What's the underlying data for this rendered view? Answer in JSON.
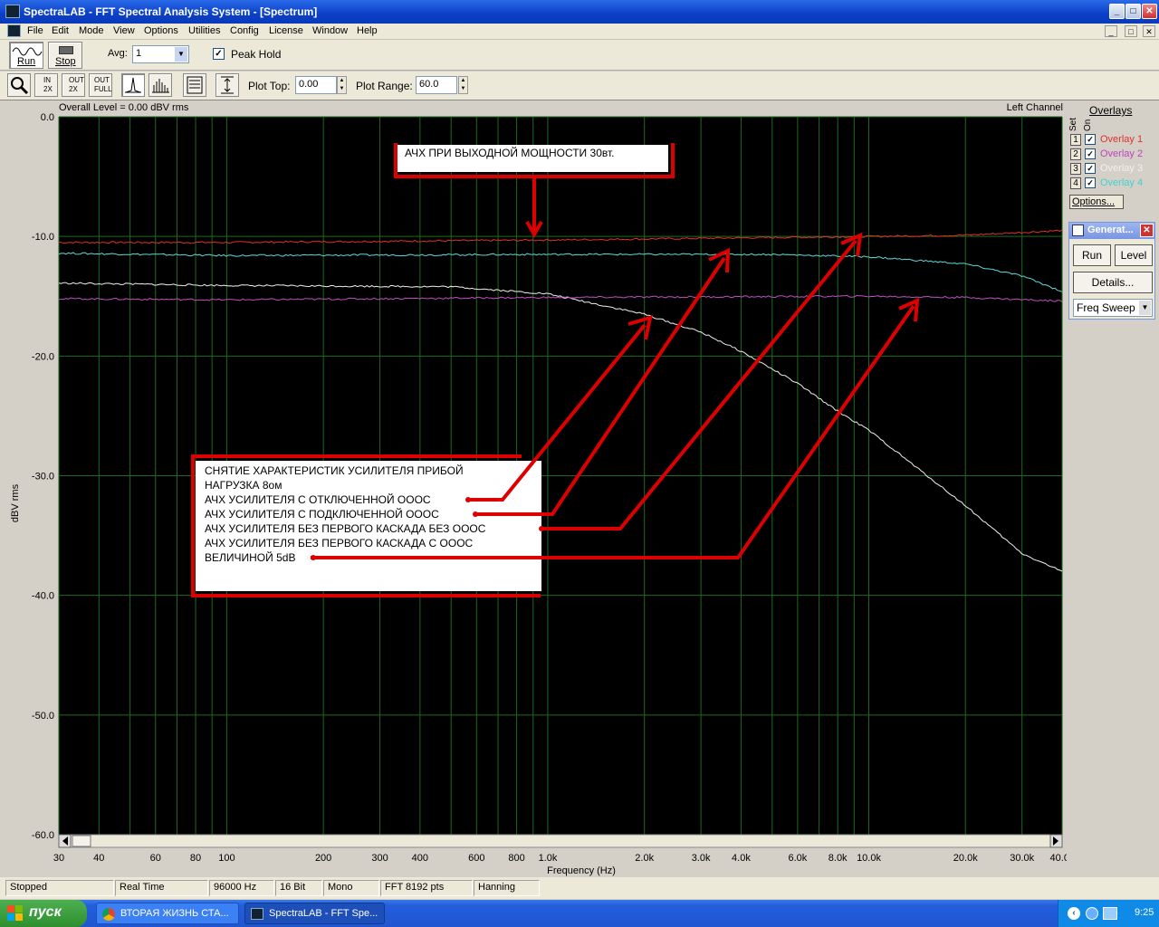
{
  "window": {
    "title": "SpectraLAB - FFT Spectral Analysis System - [Spectrum]"
  },
  "menu": [
    "File",
    "Edit",
    "Mode",
    "View",
    "Options",
    "Utilities",
    "Config",
    "License",
    "Window",
    "Help"
  ],
  "toolbar": {
    "run_label": "Run",
    "stop_label": "Stop",
    "avg_label": "Avg:",
    "avg_value": "1",
    "peak_hold_label": "Peak Hold",
    "peak_hold_checked": true,
    "zoom_in_label": "IN 2X",
    "zoom_out_label": "OUT 2X",
    "zoom_full_label": "OUT FULL",
    "plot_top_label": "Plot Top:",
    "plot_top_value": "0.00",
    "plot_range_label": "Plot Range:",
    "plot_range_value": "60.0"
  },
  "plot": {
    "overall_level": "Overall Level = 0.00 dBV rms",
    "channel": "Left Channel",
    "ylabel": "dBV rms",
    "xlabel": "Frequency (Hz)",
    "annotation_title": "АЧХ ПРИ ВЫХОДНОЙ МОЩНОСТИ 30вт.",
    "legend_lines": [
      "СНЯТИЕ ХАРАКТЕРИСТИК УСИЛИТЕЛЯ ПРИБОЙ",
      "НАГРУЗКА 8ом",
      "АЧХ УСИЛИТЕЛЯ С ОТКЛЮЧЕННОЙ ОООС",
      "АЧХ УСИЛИТЕЛЯ С ПОДКЛЮЧЕННОЙ ОООС",
      "АЧХ УСИЛИТЕЛЯ БЕЗ ПЕРВОГО КАСКАДА  БЕЗ ОООС",
      "АЧХ УСИЛИТЕЛЯ БЕЗ ПЕРВОГО КАСКАДА С ОООС",
      "ВЕЛИЧИНОЙ 5dB"
    ]
  },
  "chart_data": {
    "type": "line",
    "xlabel": "Frequency (Hz)",
    "ylabel": "dBV rms",
    "xscale": "log",
    "xlim": [
      30,
      40000
    ],
    "ylim": [
      -60,
      0
    ],
    "grid": true,
    "y_ticks": [
      "0.0",
      "-10.0",
      "-20.0",
      "-30.0",
      "-40.0",
      "-50.0",
      "-60.0"
    ],
    "x_ticks": [
      {
        "v": 30,
        "t": "30"
      },
      {
        "v": 40,
        "t": "40"
      },
      {
        "v": 60,
        "t": "60"
      },
      {
        "v": 80,
        "t": "80"
      },
      {
        "v": 100,
        "t": "100"
      },
      {
        "v": 200,
        "t": "200"
      },
      {
        "v": 300,
        "t": "300"
      },
      {
        "v": 400,
        "t": "400"
      },
      {
        "v": 600,
        "t": "600"
      },
      {
        "v": 800,
        "t": "800"
      },
      {
        "v": 1000,
        "t": "1.0k"
      },
      {
        "v": 2000,
        "t": "2.0k"
      },
      {
        "v": 3000,
        "t": "3.0k"
      },
      {
        "v": 4000,
        "t": "4.0k"
      },
      {
        "v": 6000,
        "t": "6.0k"
      },
      {
        "v": 8000,
        "t": "8.0k"
      },
      {
        "v": 10000,
        "t": "10.0k"
      },
      {
        "v": 20000,
        "t": "20.0k"
      },
      {
        "v": 30000,
        "t": "30.0k"
      },
      {
        "v": 40000,
        "t": "40.0k"
      }
    ],
    "series": [
      {
        "color": "#e03030",
        "points": [
          [
            30,
            -10.5
          ],
          [
            100,
            -10.5
          ],
          [
            1000,
            -10.3
          ],
          [
            10000,
            -10.0
          ],
          [
            20000,
            -9.9
          ],
          [
            40000,
            -9.5
          ]
        ]
      },
      {
        "color": "#60d8d8",
        "points": [
          [
            30,
            -11.4
          ],
          [
            100,
            -11.6
          ],
          [
            1000,
            -11.5
          ],
          [
            5000,
            -11.5
          ],
          [
            10000,
            -11.7
          ],
          [
            20000,
            -12.3
          ],
          [
            30000,
            -13.3
          ],
          [
            40000,
            -14.6
          ]
        ]
      },
      {
        "color": "#f0f0f0",
        "points": [
          [
            30,
            -13.9
          ],
          [
            100,
            -14.1
          ],
          [
            500,
            -14.2
          ],
          [
            1000,
            -14.8
          ],
          [
            2000,
            -16.5
          ],
          [
            3000,
            -18.0
          ],
          [
            4000,
            -19.6
          ],
          [
            6000,
            -22.3
          ],
          [
            8000,
            -24.6
          ],
          [
            10000,
            -26.2
          ],
          [
            20000,
            -32.5
          ],
          [
            30000,
            -36.5
          ],
          [
            40000,
            -38.0
          ]
        ]
      },
      {
        "color": "#c050c0",
        "points": [
          [
            30,
            -15.2
          ],
          [
            100,
            -15.3
          ],
          [
            1000,
            -15.1
          ],
          [
            10000,
            -15.0
          ],
          [
            20000,
            -15.1
          ],
          [
            40000,
            -15.4
          ]
        ]
      }
    ]
  },
  "overlays": {
    "title": "Overlays",
    "set_label": "Set",
    "on_label": "On",
    "items": [
      {
        "num": "1",
        "label": "Overlay 1",
        "color": "#e03030"
      },
      {
        "num": "2",
        "label": "Overlay 2",
        "color": "#c040c0"
      },
      {
        "num": "3",
        "label": "Overlay 3",
        "color": "#f0f0f0"
      },
      {
        "num": "4",
        "label": "Overlay 4",
        "color": "#40d0d0"
      }
    ],
    "options_label": "Options..."
  },
  "generator": {
    "title": "Generat...",
    "run_label": "Run",
    "level_label": "Level",
    "details_label": "Details...",
    "mode_value": "Freq Sweep"
  },
  "status": [
    "Stopped",
    "Real Time",
    "96000 Hz",
    "16 Bit",
    "Mono",
    "FFT 8192 pts",
    "Hanning"
  ],
  "taskbar": {
    "start_label": "пуск",
    "tasks": [
      "ВТОРАЯ ЖИЗНЬ СТА...",
      "SpectraLAB - FFT Spe..."
    ],
    "lang": "RU",
    "clock": "9:25"
  }
}
